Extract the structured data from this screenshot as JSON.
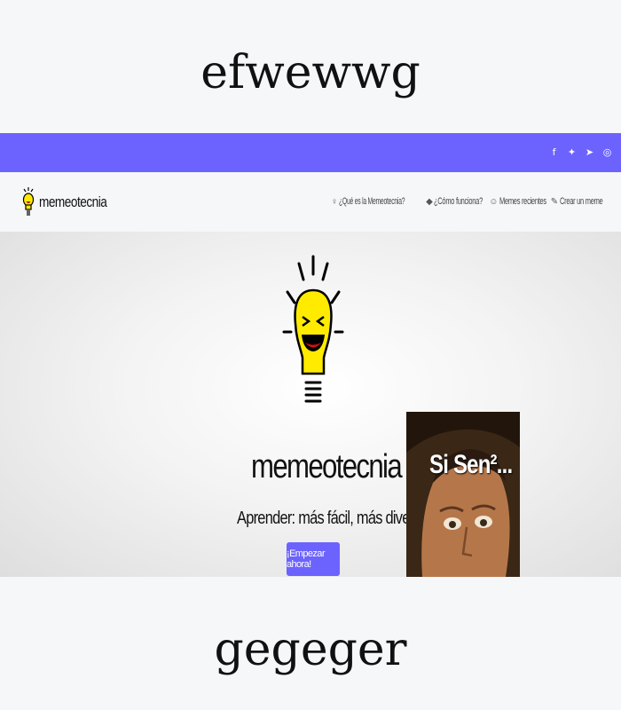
{
  "captions": {
    "top": "efwewwg",
    "bottom": "gegeger"
  },
  "colors": {
    "accent": "#6c63ff",
    "bulb": "#ffeb00"
  },
  "site": {
    "social_icons": [
      "facebook-icon",
      "twitter-icon",
      "telegram-icon",
      "instagram-icon"
    ],
    "brand": "memeotecnia",
    "nav": [
      {
        "icon": "lightbulb-icon",
        "label": "¿Qué es la Memeotecnia?"
      },
      {
        "icon": "cubes-icon",
        "label": "¿Cómo funciona?"
      },
      {
        "icon": "smile-icon",
        "label": "Memes recientes"
      },
      {
        "icon": "edit-icon",
        "label": "Crear un meme"
      }
    ],
    "hero": {
      "title": "memeotecnia",
      "tagline": "Aprender: más fácil, más divertido",
      "cta": "¡Empezar ahora!",
      "meme_text": "Si Sen²..."
    }
  }
}
